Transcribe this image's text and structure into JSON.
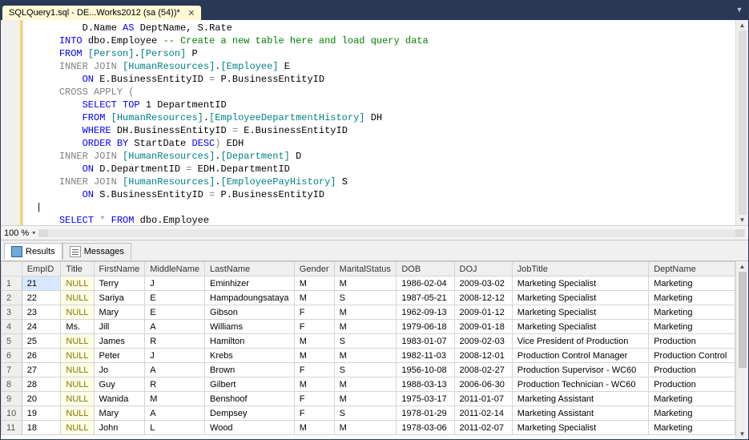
{
  "tab": {
    "title": "SQLQuery1.sql - DE...Works2012 (sa (54))*"
  },
  "zoom_label": "100 %",
  "code_tokens": [
    [
      [
        "        ",
        ""
      ],
      [
        "D",
        ""
      ],
      [
        ".",
        ""
      ],
      [
        "Name",
        ""
      ],
      [
        " ",
        ""
      ],
      [
        "AS",
        "kw"
      ],
      [
        " ",
        ""
      ],
      [
        "DeptName",
        ""
      ],
      [
        ", ",
        ""
      ],
      [
        "S",
        ""
      ],
      [
        ".",
        ""
      ],
      [
        "Rate",
        ""
      ]
    ],
    [
      [
        "    ",
        ""
      ],
      [
        "INTO",
        "kw"
      ],
      [
        " dbo",
        ""
      ],
      [
        ".",
        ""
      ],
      [
        "Employee ",
        ""
      ],
      [
        "-- Create a new table here and load query data",
        "cm"
      ]
    ],
    [
      [
        "    ",
        ""
      ],
      [
        "FROM",
        "kw"
      ],
      [
        " ",
        ""
      ],
      [
        "[Person]",
        "br"
      ],
      [
        ".",
        ""
      ],
      [
        "[Person]",
        "br"
      ],
      [
        " ",
        ""
      ],
      [
        "P",
        ""
      ]
    ],
    [
      [
        "    ",
        ""
      ],
      [
        "INNER",
        "gray"
      ],
      [
        " ",
        ""
      ],
      [
        "JOIN",
        "gray"
      ],
      [
        " ",
        ""
      ],
      [
        "[HumanResources]",
        "br"
      ],
      [
        ".",
        ""
      ],
      [
        "[Employee]",
        "br"
      ],
      [
        " ",
        ""
      ],
      [
        "E",
        ""
      ]
    ],
    [
      [
        "        ",
        ""
      ],
      [
        "ON",
        "kw"
      ],
      [
        " E",
        ""
      ],
      [
        ".",
        ""
      ],
      [
        "BusinessEntityID ",
        ""
      ],
      [
        "= ",
        "gray"
      ],
      [
        "P",
        ""
      ],
      [
        ".",
        ""
      ],
      [
        "BusinessEntityID",
        ""
      ]
    ],
    [
      [
        "    ",
        ""
      ],
      [
        "CROSS",
        "gray"
      ],
      [
        " ",
        ""
      ],
      [
        "APPLY",
        "gray"
      ],
      [
        " ",
        ""
      ],
      [
        "(",
        "gray"
      ]
    ],
    [
      [
        "        ",
        ""
      ],
      [
        "SELECT",
        "kw"
      ],
      [
        " ",
        ""
      ],
      [
        "TOP",
        "kw"
      ],
      [
        " ",
        ""
      ],
      [
        "1",
        ""
      ],
      [
        " DepartmentID",
        ""
      ]
    ],
    [
      [
        "        ",
        ""
      ],
      [
        "FROM",
        "kw"
      ],
      [
        " ",
        ""
      ],
      [
        "[HumanResources]",
        "br"
      ],
      [
        ".",
        ""
      ],
      [
        "[EmployeeDepartmentHistory]",
        "br"
      ],
      [
        " ",
        ""
      ],
      [
        "DH",
        ""
      ]
    ],
    [
      [
        "        ",
        ""
      ],
      [
        "WHERE",
        "kw"
      ],
      [
        " DH",
        ""
      ],
      [
        ".",
        ""
      ],
      [
        "BusinessEntityID ",
        ""
      ],
      [
        "= ",
        "gray"
      ],
      [
        "E",
        ""
      ],
      [
        ".",
        ""
      ],
      [
        "BusinessEntityID",
        ""
      ]
    ],
    [
      [
        "        ",
        ""
      ],
      [
        "ORDER",
        "kw"
      ],
      [
        " ",
        ""
      ],
      [
        "BY",
        "kw"
      ],
      [
        " StartDate ",
        ""
      ],
      [
        "DESC",
        "kw"
      ],
      [
        ") ",
        "gray"
      ],
      [
        "EDH",
        ""
      ]
    ],
    [
      [
        "    ",
        ""
      ],
      [
        "INNER",
        "gray"
      ],
      [
        " ",
        ""
      ],
      [
        "JOIN",
        "gray"
      ],
      [
        " ",
        ""
      ],
      [
        "[HumanResources]",
        "br"
      ],
      [
        ".",
        ""
      ],
      [
        "[Department]",
        "br"
      ],
      [
        " ",
        ""
      ],
      [
        "D",
        ""
      ]
    ],
    [
      [
        "        ",
        ""
      ],
      [
        "ON",
        "kw"
      ],
      [
        " D",
        ""
      ],
      [
        ".",
        ""
      ],
      [
        "DepartmentID ",
        ""
      ],
      [
        "= ",
        "gray"
      ],
      [
        "EDH",
        ""
      ],
      [
        ".",
        ""
      ],
      [
        "DepartmentID",
        ""
      ]
    ],
    [
      [
        "    ",
        ""
      ],
      [
        "INNER",
        "gray"
      ],
      [
        " ",
        ""
      ],
      [
        "JOIN",
        "gray"
      ],
      [
        " ",
        ""
      ],
      [
        "[HumanResources]",
        "br"
      ],
      [
        ".",
        ""
      ],
      [
        "[EmployeePayHistory]",
        "br"
      ],
      [
        " ",
        ""
      ],
      [
        "S",
        ""
      ]
    ],
    [
      [
        "        ",
        ""
      ],
      [
        "ON",
        "kw"
      ],
      [
        " S",
        ""
      ],
      [
        ".",
        ""
      ],
      [
        "BusinessEntityID ",
        ""
      ],
      [
        "= ",
        "gray"
      ],
      [
        "P",
        ""
      ],
      [
        ".",
        ""
      ],
      [
        "BusinessEntityID",
        ""
      ]
    ],
    [
      [
        "|",
        ""
      ]
    ],
    [
      [
        "    ",
        ""
      ],
      [
        "SELECT",
        "kw"
      ],
      [
        " ",
        ""
      ],
      [
        "*",
        "gray"
      ],
      [
        " ",
        ""
      ],
      [
        "FROM",
        "kw"
      ],
      [
        " dbo",
        ""
      ],
      [
        ".",
        ""
      ],
      [
        "Employee",
        ""
      ]
    ]
  ],
  "result_tabs": {
    "results": "Results",
    "messages": "Messages"
  },
  "grid": {
    "columns": [
      "EmpID",
      "Title",
      "FirstName",
      "MiddleName",
      "LastName",
      "Gender",
      "MaritalStatus",
      "DOB",
      "DOJ",
      "JobTitle",
      "DeptName"
    ],
    "rows": [
      {
        "n": "1",
        "EmpID": "21",
        "Title": null,
        "FirstName": "Terry",
        "MiddleName": "J",
        "LastName": "Eminhizer",
        "Gender": "M",
        "MaritalStatus": "M",
        "DOB": "1986-02-04",
        "DOJ": "2009-03-02",
        "JobTitle": "Marketing Specialist",
        "DeptName": "Marketing"
      },
      {
        "n": "2",
        "EmpID": "22",
        "Title": null,
        "FirstName": "Sariya",
        "MiddleName": "E",
        "LastName": "Hampadoungsataya",
        "Gender": "M",
        "MaritalStatus": "S",
        "DOB": "1987-05-21",
        "DOJ": "2008-12-12",
        "JobTitle": "Marketing Specialist",
        "DeptName": "Marketing"
      },
      {
        "n": "3",
        "EmpID": "23",
        "Title": null,
        "FirstName": "Mary",
        "MiddleName": "E",
        "LastName": "Gibson",
        "Gender": "F",
        "MaritalStatus": "M",
        "DOB": "1962-09-13",
        "DOJ": "2009-01-12",
        "JobTitle": "Marketing Specialist",
        "DeptName": "Marketing"
      },
      {
        "n": "4",
        "EmpID": "24",
        "Title": "Ms.",
        "FirstName": "Jill",
        "MiddleName": "A",
        "LastName": "Williams",
        "Gender": "F",
        "MaritalStatus": "M",
        "DOB": "1979-06-18",
        "DOJ": "2009-01-18",
        "JobTitle": "Marketing Specialist",
        "DeptName": "Marketing"
      },
      {
        "n": "5",
        "EmpID": "25",
        "Title": null,
        "FirstName": "James",
        "MiddleName": "R",
        "LastName": "Hamilton",
        "Gender": "M",
        "MaritalStatus": "S",
        "DOB": "1983-01-07",
        "DOJ": "2009-02-03",
        "JobTitle": "Vice President of Production",
        "DeptName": "Production"
      },
      {
        "n": "6",
        "EmpID": "26",
        "Title": null,
        "FirstName": "Peter",
        "MiddleName": "J",
        "LastName": "Krebs",
        "Gender": "M",
        "MaritalStatus": "M",
        "DOB": "1982-11-03",
        "DOJ": "2008-12-01",
        "JobTitle": "Production Control Manager",
        "DeptName": "Production Control"
      },
      {
        "n": "7",
        "EmpID": "27",
        "Title": null,
        "FirstName": "Jo",
        "MiddleName": "A",
        "LastName": "Brown",
        "Gender": "F",
        "MaritalStatus": "S",
        "DOB": "1956-10-08",
        "DOJ": "2008-02-27",
        "JobTitle": "Production Supervisor - WC60",
        "DeptName": "Production"
      },
      {
        "n": "8",
        "EmpID": "28",
        "Title": null,
        "FirstName": "Guy",
        "MiddleName": "R",
        "LastName": "Gilbert",
        "Gender": "M",
        "MaritalStatus": "M",
        "DOB": "1988-03-13",
        "DOJ": "2006-06-30",
        "JobTitle": "Production Technician - WC60",
        "DeptName": "Production"
      },
      {
        "n": "9",
        "EmpID": "20",
        "Title": null,
        "FirstName": "Wanida",
        "MiddleName": "M",
        "LastName": "Benshoof",
        "Gender": "F",
        "MaritalStatus": "M",
        "DOB": "1975-03-17",
        "DOJ": "2011-01-07",
        "JobTitle": "Marketing Assistant",
        "DeptName": "Marketing"
      },
      {
        "n": "10",
        "EmpID": "19",
        "Title": null,
        "FirstName": "Mary",
        "MiddleName": "A",
        "LastName": "Dempsey",
        "Gender": "F",
        "MaritalStatus": "S",
        "DOB": "1978-01-29",
        "DOJ": "2011-02-14",
        "JobTitle": "Marketing Assistant",
        "DeptName": "Marketing"
      },
      {
        "n": "11",
        "EmpID": "18",
        "Title": null,
        "FirstName": "John",
        "MiddleName": "L",
        "LastName": "Wood",
        "Gender": "M",
        "MaritalStatus": "M",
        "DOB": "1978-03-06",
        "DOJ": "2011-02-07",
        "JobTitle": "Marketing Specialist",
        "DeptName": "Marketing"
      }
    ]
  }
}
